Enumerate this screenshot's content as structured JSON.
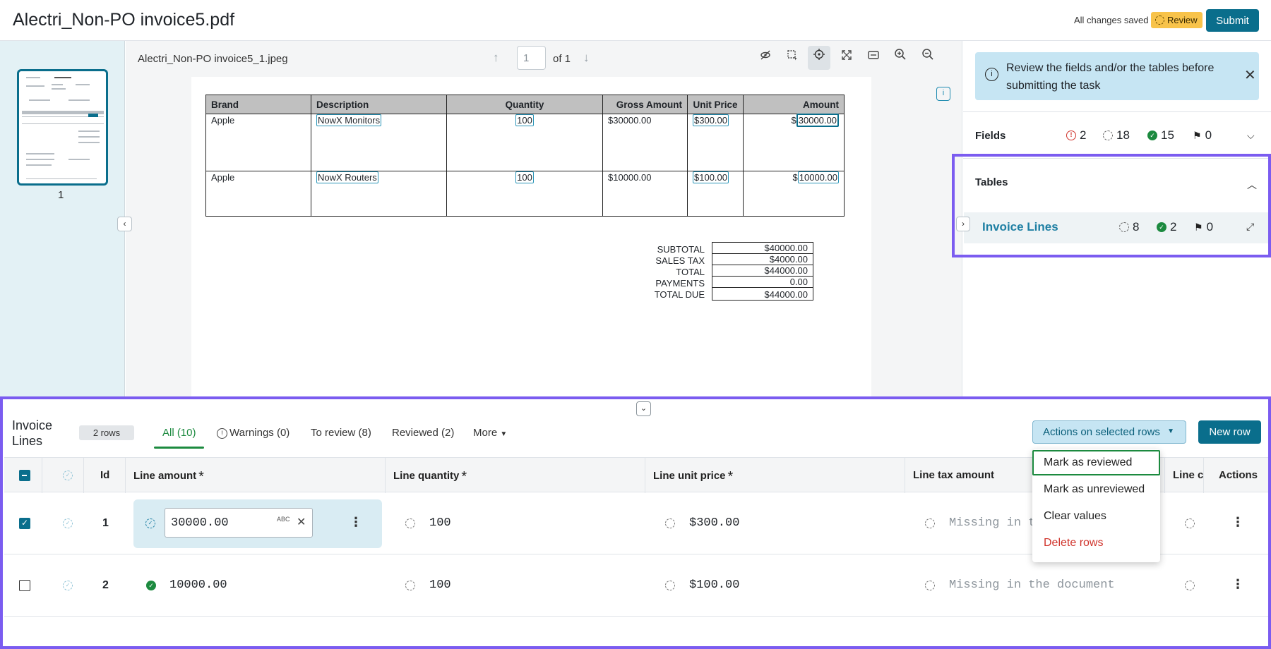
{
  "header": {
    "title": "Alectri_Non-PO invoice5.pdf",
    "save_status": "All changes saved",
    "review_badge": "Review",
    "submit_label": "Submit"
  },
  "thumbnails": {
    "page_number": "1"
  },
  "viewer": {
    "file_name": "Alectri_Non-PO invoice5_1.jpeg",
    "page_input": "1",
    "page_of": "of 1"
  },
  "invoice_doc": {
    "headers": [
      "Brand",
      "Description",
      "Quantity",
      "Gross Amount",
      "Unit Price",
      "Amount"
    ],
    "rows": [
      {
        "brand": "Apple",
        "description": "NowX Monitors",
        "quantity": "100",
        "gross_prefix": "$30000.00",
        "unit_price": "$300.00",
        "amount_prefix": "$",
        "amount": "30000.00"
      },
      {
        "brand": "Apple",
        "description": "NowX Routers",
        "quantity": "100",
        "gross_prefix": "$10000.00",
        "unit_price": "$100.00",
        "amount_prefix": "$",
        "amount": "10000.00"
      }
    ],
    "totals": [
      {
        "label": "SUBTOTAL",
        "value": "$40000.00"
      },
      {
        "label": "SALES TAX",
        "value": "$4000.00"
      },
      {
        "label": "TOTAL",
        "value": "$44000.00"
      },
      {
        "label": "PAYMENTS",
        "value": "0.00"
      },
      {
        "label": "TOTAL DUE",
        "value": "$44000.00"
      }
    ]
  },
  "right_panel": {
    "banner": "Review the fields and/or the tables before submitting the task",
    "fields": {
      "title": "Fields",
      "errors": "2",
      "pending": "18",
      "reviewed": "15",
      "flagged": "0"
    },
    "tables": {
      "title": "Tables",
      "item_name": "Invoice Lines",
      "pending": "8",
      "reviewed": "2",
      "flagged": "0"
    }
  },
  "bottom_panel": {
    "title": "Invoice Lines",
    "rows_badge": "2 rows",
    "tabs": [
      {
        "label": "All (10)"
      },
      {
        "label": "Warnings (0)"
      },
      {
        "label": "To review (8)"
      },
      {
        "label": "Reviewed (2)"
      },
      {
        "label": "More"
      }
    ],
    "actions_label": "Actions on selected rows",
    "new_row_label": "New row",
    "columns": {
      "id": "Id",
      "line_amount": "Line amount",
      "line_quantity": "Line quantity",
      "line_unit_price": "Line unit price",
      "line_tax_amount": "Line tax amount",
      "line_c": "Line c",
      "actions": "Actions",
      "required_mark": "*"
    },
    "rows": [
      {
        "id": "1",
        "amount": "30000.00",
        "quantity": "100",
        "unit_price": "$300.00",
        "tax": "Missing in t",
        "selected": true
      },
      {
        "id": "2",
        "amount": "10000.00",
        "quantity": "100",
        "unit_price": "$100.00",
        "tax": "Missing in the document",
        "selected": false
      }
    ],
    "edit_hint": "ABC"
  },
  "dropdown": {
    "items": [
      {
        "label": "Mark as reviewed"
      },
      {
        "label": "Mark as unreviewed"
      },
      {
        "label": "Clear values"
      },
      {
        "label": "Delete rows"
      }
    ]
  },
  "colors": {
    "accent": "#0a6e8c",
    "highlight": "#7b5cf0",
    "success": "#1c8a3f",
    "danger": "#d0342c",
    "warning": "#f8c34a"
  }
}
